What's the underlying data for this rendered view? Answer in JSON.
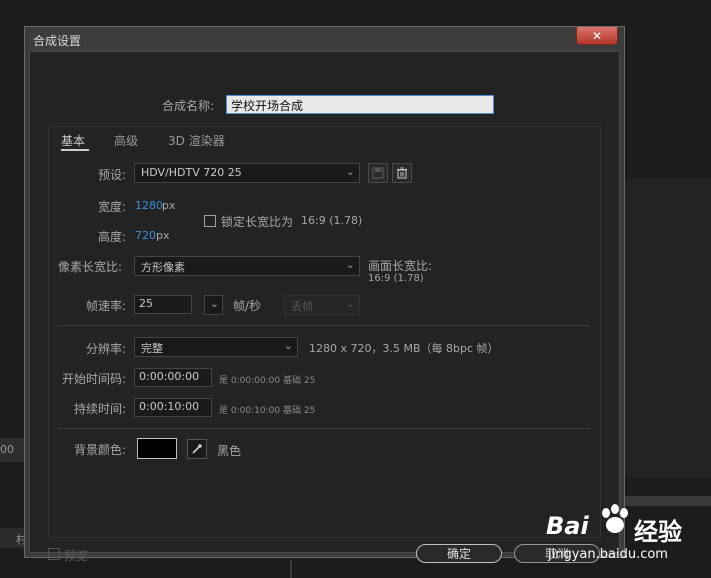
{
  "window": {
    "title": "合成设置",
    "close_symbol": "✕"
  },
  "comp_name": {
    "label": "合成名称:",
    "value": "学校开场合成"
  },
  "tabs": [
    {
      "label": "基本"
    },
    {
      "label": "高级"
    },
    {
      "label": "3D 渲染器"
    }
  ],
  "basic": {
    "preset": {
      "label": "预设:",
      "value": "HDV/HDTV 720 25"
    },
    "width": {
      "label": "宽度:",
      "value": "1280",
      "unit": "px"
    },
    "height": {
      "label": "高度:",
      "value": "720",
      "unit": "px"
    },
    "lock_aspect": {
      "label": "锁定长宽比为",
      "ratio": "16:9 (1.78)",
      "checked": false
    },
    "pixel_aspect": {
      "label": "像素长宽比:",
      "value": "方形像素"
    },
    "frame_aspect": {
      "label": "画面长宽比:",
      "value": "16:9 (1.78)"
    },
    "frame_rate": {
      "label": "帧速率:",
      "value": "25",
      "unit": "帧/秒",
      "drop_frame": "丢帧"
    },
    "resolution": {
      "label": "分辨率:",
      "value": "完整",
      "info": "1280 x 720，3.5 MB（每 8bpc 帧）"
    },
    "start_timecode": {
      "label": "开始时间码:",
      "value": "0:00:00:00",
      "equals": "是 0:00:00:00",
      "base": "基础 25"
    },
    "duration": {
      "label": "持续时间:",
      "value": "0:00:10:00",
      "equals": "是 0:00:10:00",
      "base": "基础 25"
    },
    "bg_color": {
      "label": "背景颜色:",
      "color": "#000000",
      "name": "黑色"
    }
  },
  "footer": {
    "preview_label": "预览",
    "ok_label": "确定",
    "cancel_label": "取消"
  },
  "background": {
    "timecode_fragment": "00",
    "fragment_char": "村"
  },
  "watermark": {
    "brand": "Bai",
    "brand2": "经验",
    "url": "jingyan.baidu.com"
  },
  "colors": {
    "accent_blue": "#3b90d8",
    "close_red": "#c44a3f",
    "focus_blue": "#4f8fd6"
  }
}
